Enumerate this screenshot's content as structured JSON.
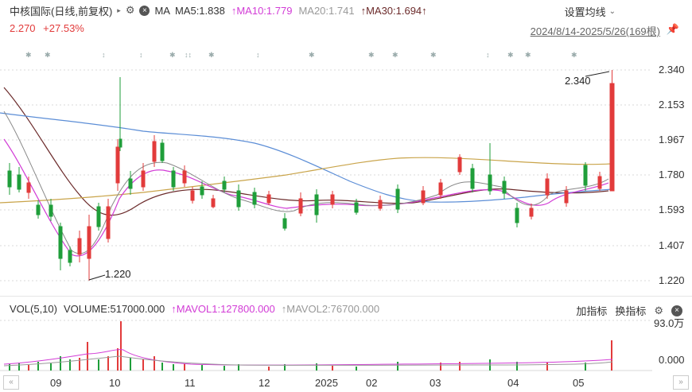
{
  "header": {
    "title": "中核国际(日线,前复权)",
    "ma_label": "MA",
    "ma5": "MA5:1.838",
    "ma10": "MA10:1.779",
    "ma20": "MA20:1.741",
    "ma30": "MA30:1.694",
    "price": "2.270",
    "change": "+27.53%",
    "settings_label": "设置均线",
    "date_range": "2024/8/14-2025/5/26(169根)"
  },
  "price_axis": [
    "2.340",
    "2.153",
    "1.967",
    "1.780",
    "1.593",
    "1.407",
    "1.220"
  ],
  "annotations": {
    "high": "2.340",
    "low": "1.220"
  },
  "volume": {
    "label": "VOL(5,10)",
    "volume": "VOLUME:517000.000",
    "mavol1": "MAVOL1:127800.000",
    "mavol2": "MAVOL2:76700.000",
    "add_indicator": "加指标",
    "switch_indicator": "换指标",
    "axis_top": "93.0万",
    "axis_bottom": "0.000"
  },
  "x_axis": [
    "09",
    "10",
    "11",
    "12",
    "2025",
    "02",
    "03",
    "04",
    "05"
  ],
  "colors": {
    "up": "#e23b3b",
    "down": "#1f9e3a",
    "ma5": "#d23cd6",
    "ma10": "#6b2a2a",
    "ma20": "#b4a37a",
    "ma30": "#5b8dd6",
    "grid": "#d7d7d7"
  },
  "chart_data": {
    "type": "candlestick",
    "yrange": [
      1.22,
      2.34
    ],
    "high": 2.34,
    "low": 1.22,
    "last_close": 2.27
  }
}
